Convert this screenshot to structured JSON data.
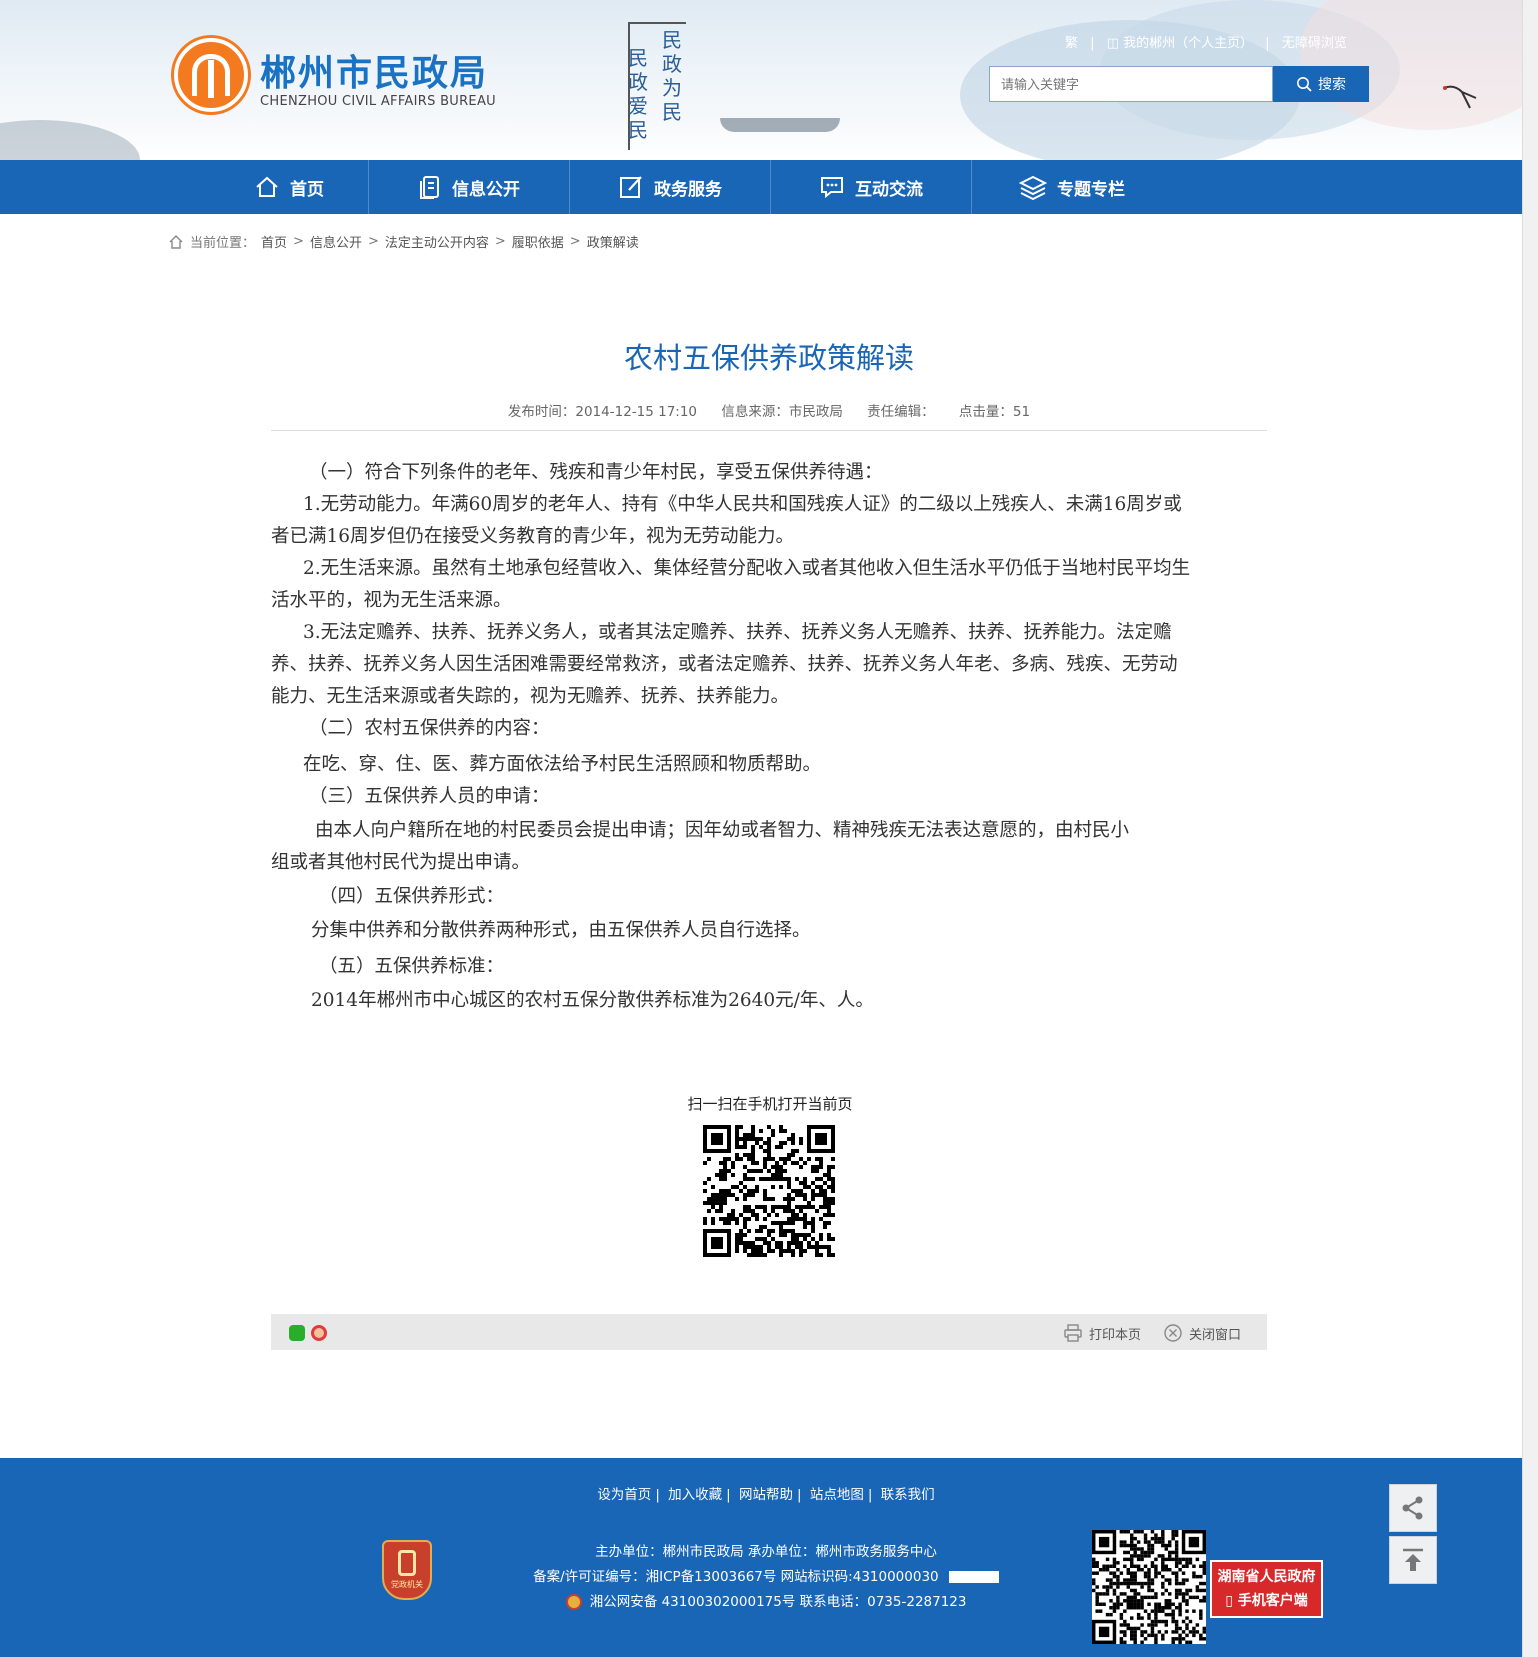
{
  "header": {
    "site_name_cn": "郴州市民政局",
    "site_name_en": "CHENZHOU CIVIL AFFAIRS BUREAU",
    "slogan_right": "民政为民",
    "slogan_left": "民政爱民",
    "toplinks": {
      "traditional": "繁",
      "my_chenzhou": "我的郴州（个人主页）",
      "accessible": "无障碍浏览"
    },
    "search": {
      "placeholder": "请输入关键字",
      "button": "搜索"
    }
  },
  "nav": {
    "items": [
      {
        "label": "首页",
        "icon": "home-icon"
      },
      {
        "label": "信息公开",
        "icon": "document-icon"
      },
      {
        "label": "政务服务",
        "icon": "edit-icon"
      },
      {
        "label": "互动交流",
        "icon": "chat-icon"
      },
      {
        "label": "专题专栏",
        "icon": "layers-icon"
      }
    ]
  },
  "breadcrumb": {
    "prefix": "当前位置：",
    "items": [
      "首页",
      "信息公开",
      "法定主动公开内容",
      "履职依据",
      "政策解读"
    ],
    "separator": ">"
  },
  "article": {
    "title": "农村五保供养政策解读",
    "meta": {
      "publish_time": "发布时间：2014-12-15 17:10",
      "source": "信息来源：市民政局",
      "editor": "责任编辑：",
      "hits": "点击量：51"
    },
    "paragraphs": [
      "（一）符合下列条件的老年、残疾和青少年村民，享受五保供养待遇：",
      "1.无劳动能力。年满60周岁的老年人、持有《中华人民共和国残疾人证》的二级以上残疾人、未满16周岁或",
      "者已满16周岁但仍在接受义务教育的青少年，视为无劳动能力。",
      "2.无生活来源。虽然有土地承包经营收入、集体经营分配收入或者其他收入但生活水平仍低于当地村民平均生",
      "活水平的，视为无生活来源。",
      "3.无法定赡养、扶养、抚养义务人，或者其法定赡养、扶养、抚养义务人无赡养、扶养、抚养能力。法定赡",
      "养、扶养、抚养义务人因生活困难需要经常救济，或者法定赡养、扶养、抚养义务人年老、多病、残疾、无劳动",
      "能力、无生活来源或者失踪的，视为无赡养、抚养、扶养能力。",
      "（二）农村五保供养的内容：",
      "在吃、穿、住、医、葬方面依法给予村民生活照顾和物质帮助。",
      "（三）五保供养人员的申请：",
      "由本人向户籍所在地的村民委员会提出申请；因年幼或者智力、精神残疾无法表达意愿的，由村民小",
      "组或者其他村民代为提出申请。",
      "（四）五保供养形式：",
      "分集中供养和分散供养两种形式，由五保供养人员自行选择。",
      "（五）五保供养标准：",
      "2014年郴州市中心城区的农村五保分散供养标准为2640元/年、人。"
    ]
  },
  "qr": {
    "label": "扫一扫在手机打开当前页"
  },
  "share_bar": {
    "print": "打印本页",
    "close": "关闭窗口"
  },
  "footer": {
    "links": [
      "设为首页",
      "加入收藏",
      "网站帮助",
      "站点地图",
      "联系我们"
    ],
    "line1": "主办单位：郴州市民政局   承办单位：郴州市政务服务中心",
    "line2": "备案/许可证编号：湘ICP备13003667号    网站标识码:4310000030",
    "line3": "湘公网安备 43100302000175号    联系电话：0735-2287123",
    "badge_text": "党政机关",
    "gov_app_line1": "湖南省人民政府",
    "gov_app_line2": "手机客户端"
  },
  "colors": {
    "primary": "#1965b6",
    "accent": "#f47a20",
    "app_red": "#d7282a"
  }
}
